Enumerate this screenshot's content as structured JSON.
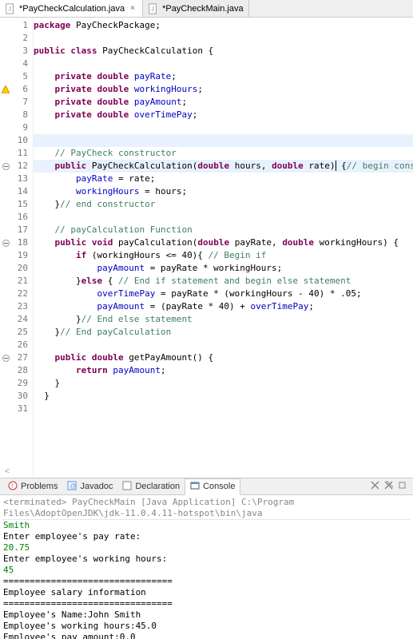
{
  "tabs": [
    {
      "label": "*PayCheckCalculation.java",
      "active": true
    },
    {
      "label": "*PayCheckMain.java",
      "active": false
    }
  ],
  "code": {
    "lines": [
      {
        "n": 1,
        "html": "<span class='kw'>package</span> PayCheckPackage;"
      },
      {
        "n": 2,
        "html": ""
      },
      {
        "n": 3,
        "html": "<span class='kw'>public class</span> PayCheckCalculation {"
      },
      {
        "n": 4,
        "html": ""
      },
      {
        "n": 5,
        "html": "    <span class='kw'>private double</span> <span class='fld'>payRate</span>;"
      },
      {
        "n": 6,
        "html": "    <span class='kw'>private double</span> <span class='fld'>workingHours</span>;",
        "warn": true
      },
      {
        "n": 7,
        "html": "    <span class='kw'>private double</span> <span class='fld'>payAmount</span>;"
      },
      {
        "n": 8,
        "html": "    <span class='kw'>private double</span> <span class='fld'>overTimePay</span>;"
      },
      {
        "n": 9,
        "html": ""
      },
      {
        "n": 10,
        "html": "",
        "hl": true
      },
      {
        "n": 11,
        "html": "    <span class='cmt'>// PayCheck constructor</span>"
      },
      {
        "n": 12,
        "html": "    <span class='kw'>public</span> PayCheckCalculation(<span class='kw'>double</span> hours, <span class='kw'>double</span> rate<span class='caret'>)</span> {<span class='cmt'>// begin constructor</span>",
        "fold": true,
        "hl": true
      },
      {
        "n": 13,
        "html": "        <span class='fld'>payRate</span> = rate;"
      },
      {
        "n": 14,
        "html": "        <span class='fld'>workingHours</span> = hours;"
      },
      {
        "n": 15,
        "html": "    }<span class='cmt'>// end constructor</span>"
      },
      {
        "n": 16,
        "html": ""
      },
      {
        "n": 17,
        "html": "    <span class='cmt'>// payCalculation Function</span>"
      },
      {
        "n": 18,
        "html": "    <span class='kw'>public void</span> payCalculation(<span class='kw'>double</span> payRate, <span class='kw'>double</span> workingHours) {",
        "fold": true
      },
      {
        "n": 19,
        "html": "        <span class='kw'>if</span> (workingHours &lt;= 40){ <span class='cmt'>// Begin if</span>"
      },
      {
        "n": 20,
        "html": "            <span class='fld'>payAmount</span> = payRate * workingHours;"
      },
      {
        "n": 21,
        "html": "        }<span class='kw'>else</span> { <span class='cmt'>// End if statement and begin else statement</span>"
      },
      {
        "n": 22,
        "html": "            <span class='fld'>overTimePay</span> = payRate * (workingHours - 40) * .05;"
      },
      {
        "n": 23,
        "html": "            <span class='fld'>payAmount</span> = (payRate * 40) + <span class='fld'>overTimePay</span>;"
      },
      {
        "n": 24,
        "html": "        }<span class='cmt'>// End else statement</span>"
      },
      {
        "n": 25,
        "html": "    }<span class='cmt'>// End payCalculation</span>"
      },
      {
        "n": 26,
        "html": ""
      },
      {
        "n": 27,
        "html": "    <span class='kw'>public double</span> getPayAmount() {",
        "fold": true
      },
      {
        "n": 28,
        "html": "        <span class='kw'>return</span> <span class='fld'>payAmount</span>;"
      },
      {
        "n": 29,
        "html": "    }"
      },
      {
        "n": 30,
        "html": "  }"
      },
      {
        "n": 31,
        "html": ""
      }
    ]
  },
  "bottom_tabs": {
    "problems": "Problems",
    "javadoc": "Javadoc",
    "declaration": "Declaration",
    "console": "Console"
  },
  "console": {
    "terminated": "<terminated> PayCheckMain [Java Application] C:\\Program Files\\AdoptOpenJDK\\jdk-11.0.4.11-hotspot\\bin\\java",
    "lines": [
      {
        "text": "Smith",
        "cls": "in"
      },
      {
        "text": "Enter employee's pay rate:",
        "cls": "out"
      },
      {
        "text": "20.75",
        "cls": "in"
      },
      {
        "text": "Enter employee's working hours:",
        "cls": "out"
      },
      {
        "text": "45",
        "cls": "in"
      },
      {
        "text": "================================",
        "cls": "out"
      },
      {
        "text": "Employee salary information",
        "cls": "out"
      },
      {
        "text": "================================",
        "cls": "out"
      },
      {
        "text": "Employee's Name:John Smith",
        "cls": "out"
      },
      {
        "text": "Employee's working hours:45.0",
        "cls": "out"
      },
      {
        "text": "Employee's pay amount:0.0",
        "cls": "out"
      }
    ]
  },
  "icons": {
    "scroll_hint": "<"
  }
}
